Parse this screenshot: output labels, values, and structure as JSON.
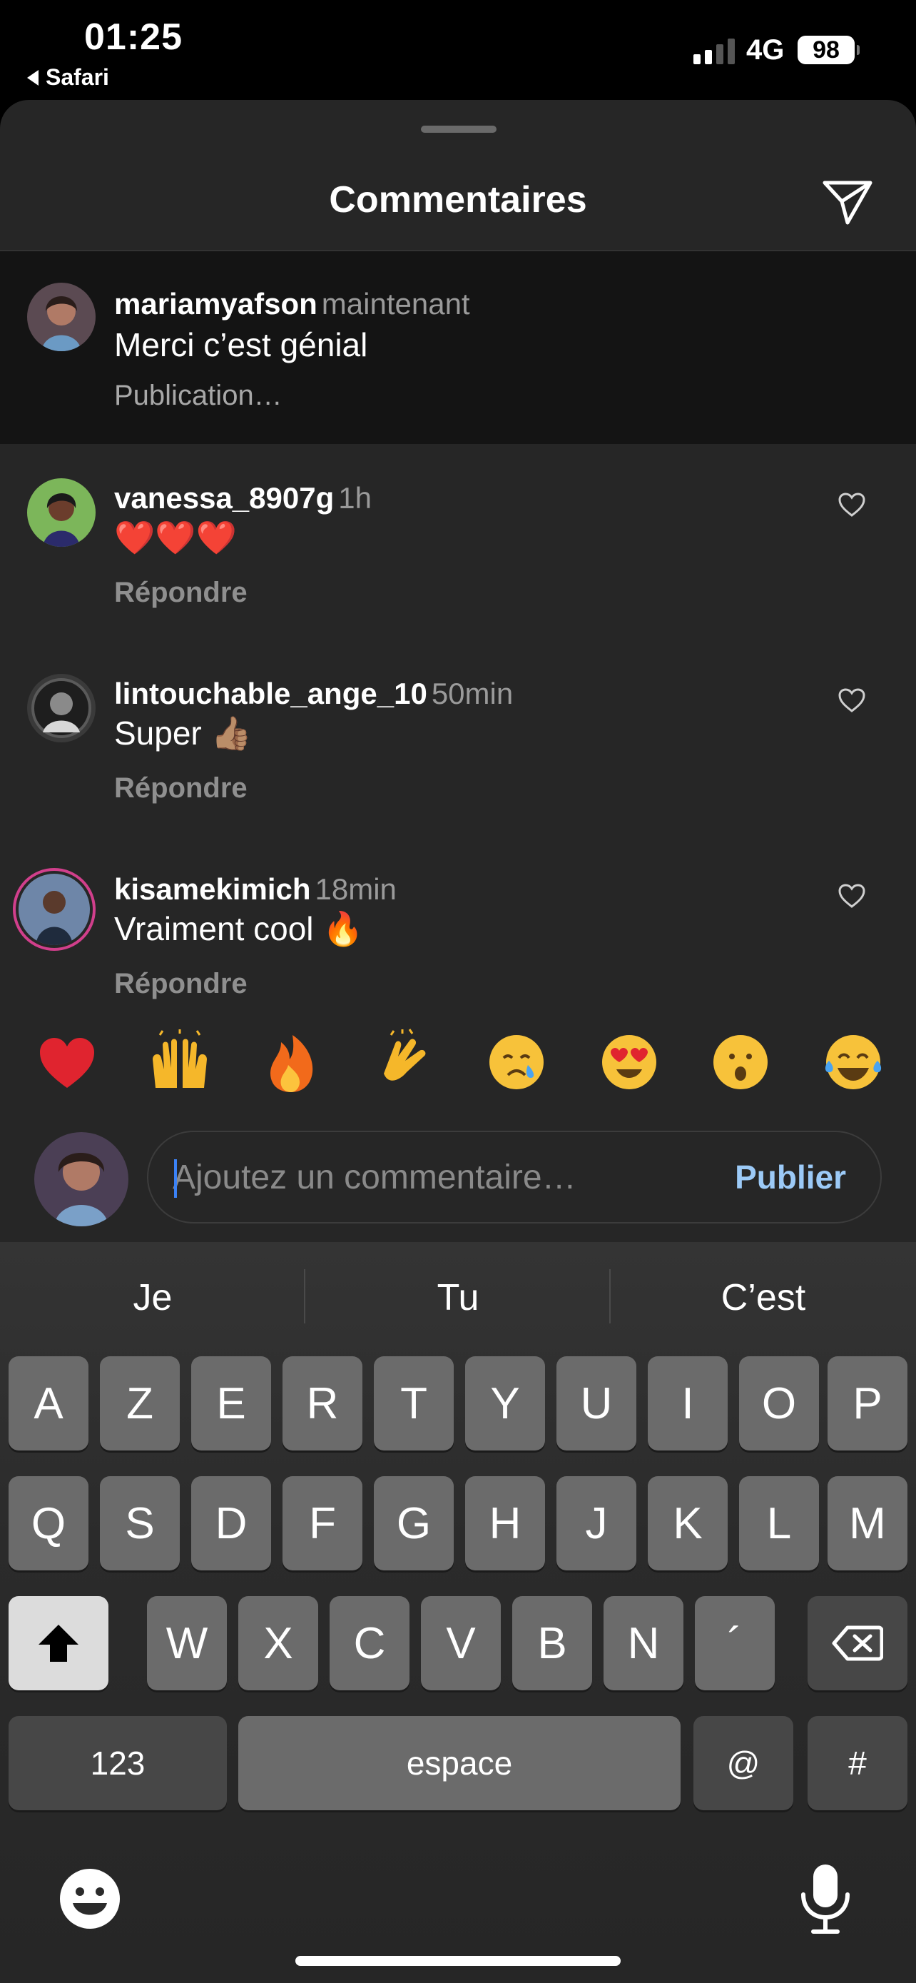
{
  "status_bar": {
    "time": "01:25",
    "back_app": "Safari",
    "network": "4G",
    "battery": "98"
  },
  "sheet": {
    "title": "Commentaires",
    "send_icon": "paper-plane-icon"
  },
  "comments": [
    {
      "username": "mariamyafson",
      "time": "maintenant",
      "text": "Merci c’est génial",
      "action": "Publication…",
      "avatar_color": "#b36a5e"
    },
    {
      "username": "vanessa_8907g",
      "time": "1h",
      "text": "❤️❤️❤️",
      "action": "Répondre",
      "avatar_color": "#6aa84f"
    },
    {
      "username": "lintouchable_ange_10",
      "time": "50min",
      "text": "Super 👍🏽",
      "action": "Répondre",
      "avatar_color": "#4a4a4a"
    },
    {
      "username": "kisamekimich",
      "time": "18min",
      "text": "Vraiment cool 🔥",
      "action": "Répondre",
      "avatar_color": "#3d5a80"
    }
  ],
  "reactions": [
    "❤️",
    "🙌",
    "🔥",
    "👏",
    "😢",
    "😍",
    "😮",
    "😂"
  ],
  "composer": {
    "placeholder": "Ajoutez un commentaire…",
    "publish_label": "Publier"
  },
  "keyboard": {
    "suggestions": [
      "Je",
      "Tu",
      "C’est"
    ],
    "row1": [
      "A",
      "Z",
      "E",
      "R",
      "T",
      "Y",
      "U",
      "I",
      "O",
      "P"
    ],
    "row2": [
      "Q",
      "S",
      "D",
      "F",
      "G",
      "H",
      "J",
      "K",
      "L",
      "M"
    ],
    "row3": [
      "W",
      "X",
      "C",
      "V",
      "B",
      "N",
      "´"
    ],
    "numbers_label": "123",
    "space_label": "espace",
    "at_label": "@",
    "hash_label": "#"
  },
  "colors": {
    "sheet_bg": "#262626",
    "highlight_bg": "#141414",
    "publish": "#9ccaf7",
    "caret": "#3b82f6"
  }
}
